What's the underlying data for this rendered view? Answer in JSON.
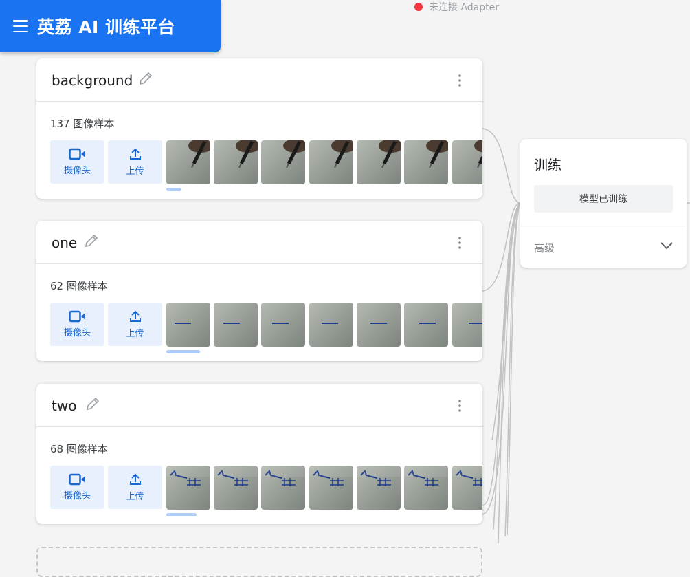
{
  "app": {
    "title": "英荔 AI 训练平台",
    "brand_color": "#1a73f0"
  },
  "status": {
    "text": "未连接 Adapter",
    "dot_color": "#f3363f"
  },
  "classes": [
    {
      "name": "background",
      "count_text": "137 图像样本",
      "webcam_label": "摄像头",
      "upload_label": "上传",
      "thumb_variant": "pen"
    },
    {
      "name": "one",
      "count_text": "62 图像样本",
      "webcam_label": "摄像头",
      "upload_label": "上传",
      "thumb_variant": "one"
    },
    {
      "name": "two",
      "count_text": "68 图像样本",
      "webcam_label": "摄像头",
      "upload_label": "上传",
      "thumb_variant": "two"
    }
  ],
  "training": {
    "title": "训练",
    "button_label": "模型已训练",
    "advanced_label": "高级"
  },
  "icons": {
    "menu": "menu-icon",
    "edit": "pencil-icon",
    "more": "more-vert-icon",
    "webcam": "video-camera-icon",
    "upload": "upload-icon",
    "expand": "chevron-down-icon"
  }
}
